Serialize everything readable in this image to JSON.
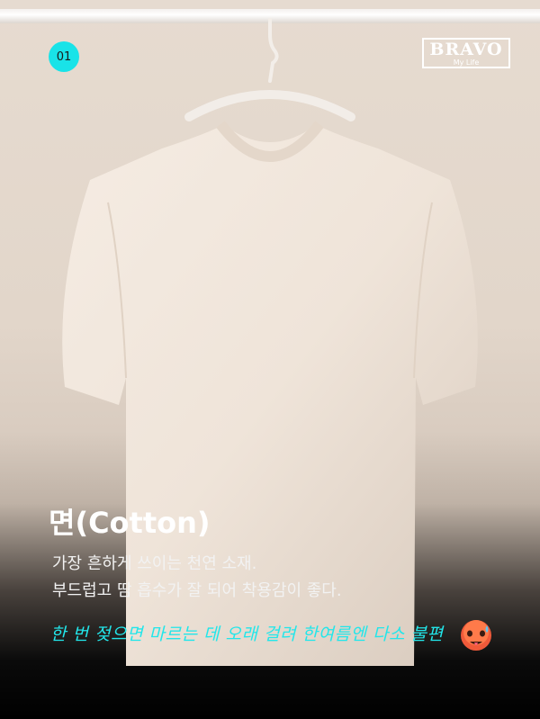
{
  "badge": {
    "number": "01"
  },
  "logo": {
    "brand": "BRAVO",
    "tagline": "My Life"
  },
  "title": "면(Cotton)",
  "description": [
    "가장 흔하게 쓰이는 천연 소재.",
    "부드럽고 땀 흡수가 잘 되어 착용감이 좋다."
  ],
  "tip": "한 번 젖으면 마르는 데 오래 걸려  한여름엔 다소 불편",
  "emoji": "hot-face-emoji",
  "colors": {
    "accent": "#19e3e8",
    "text": "#ffffff",
    "shirt": "#f1e7de"
  }
}
